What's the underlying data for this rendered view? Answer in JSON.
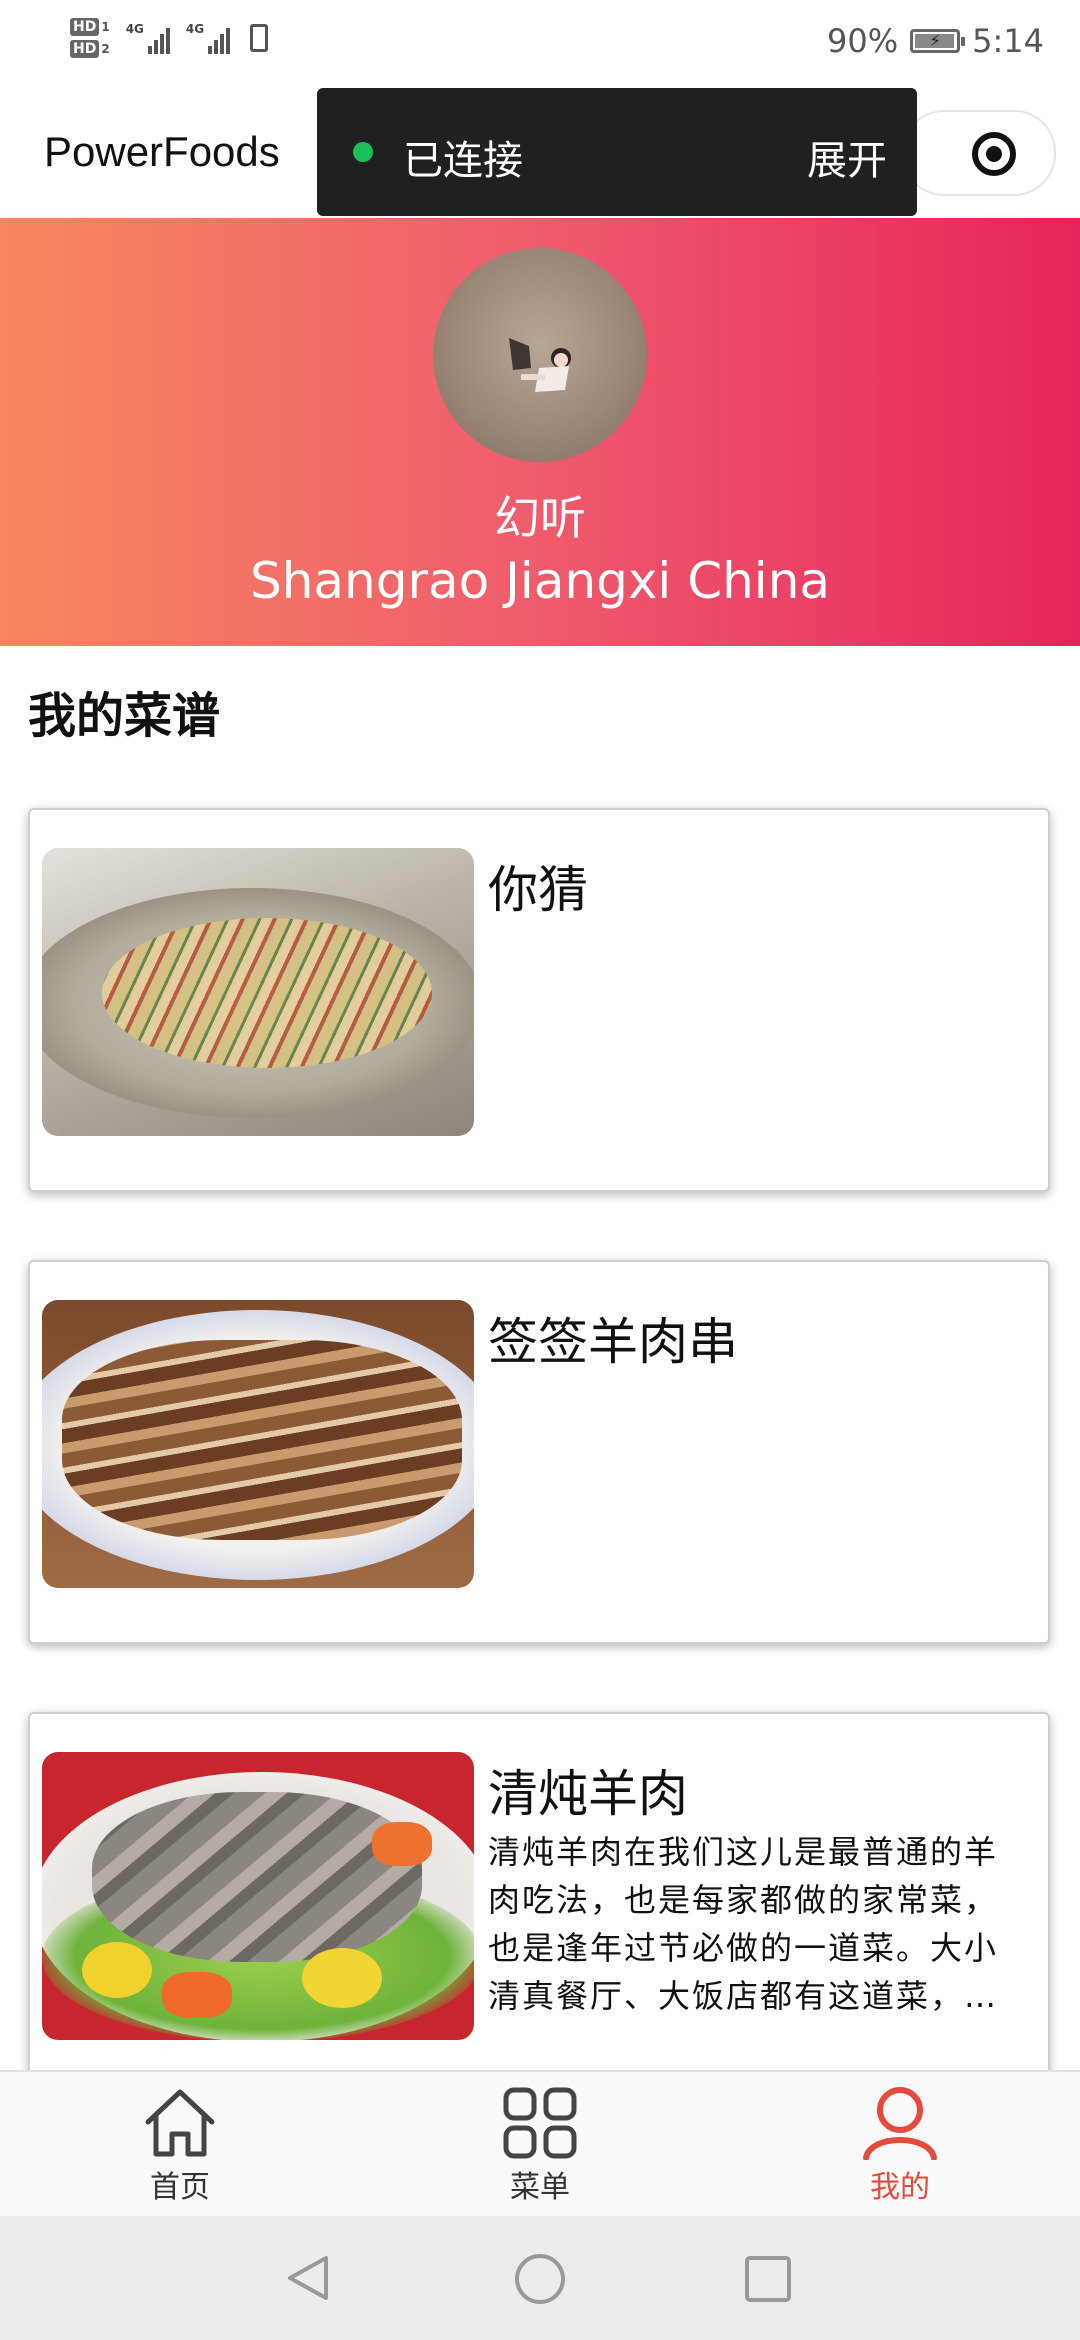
{
  "status_bar": {
    "hd1": "HD",
    "hd1_num": "1",
    "hd2": "HD",
    "hd2_num": "2",
    "net1": "4G",
    "net2": "4G",
    "battery": "90%",
    "time": "5:14"
  },
  "nav": {
    "title": "PowerFoods"
  },
  "connection": {
    "status": "已连接",
    "expand": "展开",
    "dot_color": "#19c05a"
  },
  "profile": {
    "name": "幻听",
    "location": "Shangrao Jiangxi China",
    "gradient": [
      "#f7875e",
      "#e7245b"
    ]
  },
  "section": {
    "title": "我的菜谱"
  },
  "recipes": [
    {
      "title": "你猜",
      "description": ""
    },
    {
      "title": "签签羊肉串",
      "description": ""
    },
    {
      "title": "清炖羊肉",
      "description": "清炖羊肉在我们这儿是最普通的羊肉吃法，也是每家都做的家常菜，也是逢年过节必做的一道菜。大小清真餐厅、大饭店都有这道菜，凡是各种宴席都少不了这道菜。这…"
    }
  ],
  "tabs": [
    {
      "label": "首页",
      "icon": "home-icon",
      "active": false
    },
    {
      "label": "菜单",
      "icon": "grid-icon",
      "active": false
    },
    {
      "label": "我的",
      "icon": "user-icon",
      "active": true
    }
  ],
  "colors": {
    "active_tab": "#e64a3c",
    "inactive_tab": "#333333"
  }
}
